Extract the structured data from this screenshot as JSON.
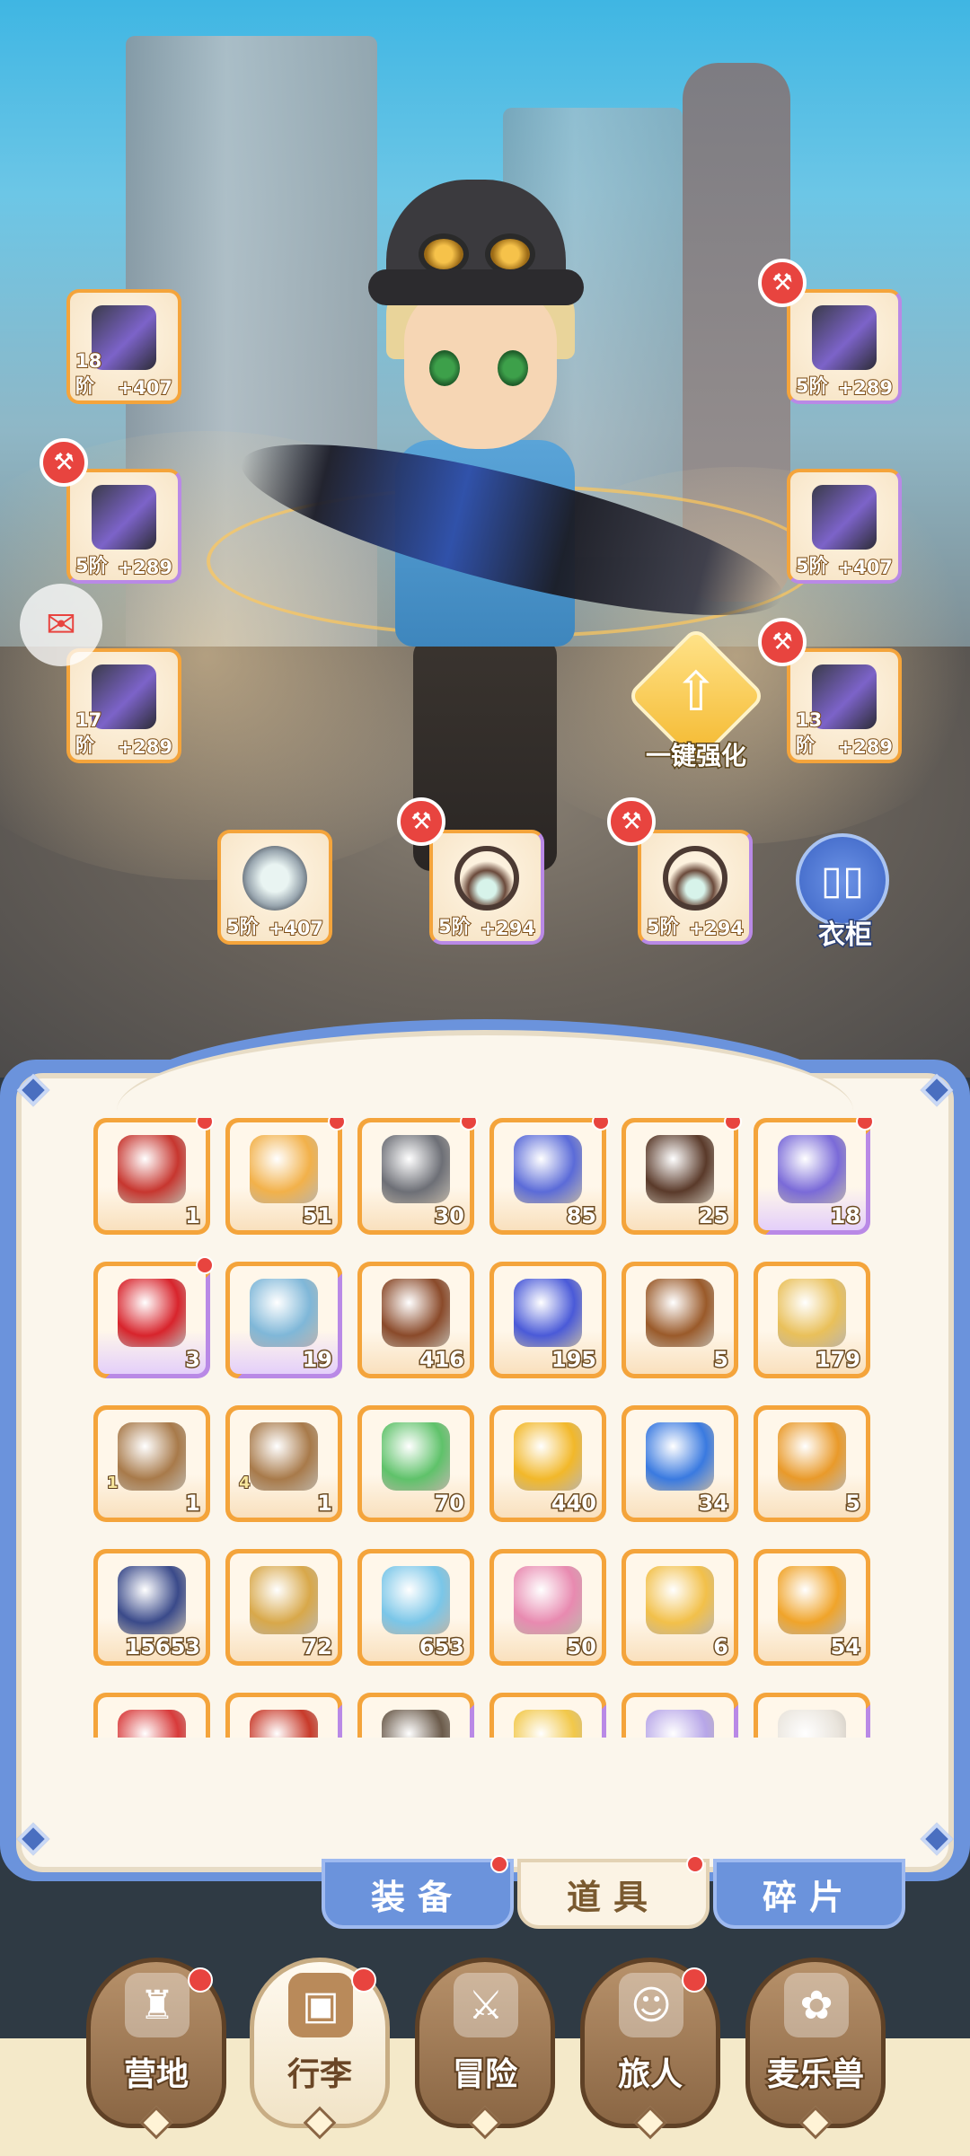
{
  "equipment": {
    "left": [
      {
        "id": "bow",
        "stage": "18阶",
        "bonus": "+407",
        "rarity": "orange",
        "badge": false,
        "art": "bow-art"
      },
      {
        "id": "chest",
        "stage": "5阶",
        "bonus": "+289",
        "rarity": "purple",
        "badge": true,
        "art": ""
      },
      {
        "id": "belt",
        "stage": "17阶",
        "bonus": "+289",
        "rarity": "orange",
        "badge": false,
        "art": ""
      }
    ],
    "right": [
      {
        "id": "helmet",
        "stage": "5阶",
        "bonus": "+289",
        "rarity": "purple",
        "badge": true,
        "art": ""
      },
      {
        "id": "gloves",
        "stage": "5阶",
        "bonus": "+407",
        "rarity": "purple",
        "badge": false,
        "art": ""
      },
      {
        "id": "boots",
        "stage": "13阶",
        "bonus": "+289",
        "rarity": "orange",
        "badge": true,
        "art": ""
      }
    ],
    "bottom": [
      {
        "id": "ring",
        "stage": "5阶",
        "bonus": "+407",
        "rarity": "orange",
        "badge": false,
        "art": "ring-art"
      },
      {
        "id": "necklace-1",
        "stage": "5阶",
        "bonus": "+294",
        "rarity": "purple",
        "badge": true,
        "art": "neck-art"
      },
      {
        "id": "necklace-2",
        "stage": "5阶",
        "bonus": "+294",
        "rarity": "purple",
        "badge": true,
        "art": "neck-art"
      }
    ]
  },
  "actions": {
    "auto_enhance_label": "一键强化",
    "wardrobe_label": "衣柜"
  },
  "inventory": {
    "items": [
      {
        "count": "1",
        "rarity": "orange",
        "dot": true,
        "icon": "treasure-chest-icon",
        "color": "#c7362f"
      },
      {
        "count": "51",
        "rarity": "orange",
        "dot": true,
        "icon": "scroll-fragment-icon",
        "color": "#f2b14a"
      },
      {
        "count": "30",
        "rarity": "orange",
        "dot": true,
        "icon": "ore-fragment-icon",
        "color": "#6d6f76"
      },
      {
        "count": "85",
        "rarity": "orange",
        "dot": true,
        "icon": "blue-fragment-icon",
        "color": "#5b6bd8"
      },
      {
        "count": "25",
        "rarity": "orange",
        "dot": true,
        "icon": "bell-hat-icon",
        "color": "#5a3a2a"
      },
      {
        "count": "18",
        "rarity": "purple",
        "dot": true,
        "icon": "purple-fragment-icon",
        "color": "#7a6ad8"
      },
      {
        "count": "3",
        "rarity": "purple",
        "dot": true,
        "icon": "apple-icon",
        "color": "#d8242c"
      },
      {
        "count": "19",
        "rarity": "purple",
        "dot": false,
        "icon": "silver-chest-icon",
        "color": "#7fb7d8"
      },
      {
        "count": "416",
        "rarity": "orange",
        "dot": false,
        "icon": "brown-ticket-icon",
        "color": "#8a4a2a"
      },
      {
        "count": "195",
        "rarity": "orange",
        "dot": false,
        "icon": "blue-ticket-icon",
        "color": "#4a5ad8"
      },
      {
        "count": "5",
        "rarity": "orange",
        "dot": false,
        "icon": "wood-log-icon",
        "color": "#9a5a2a"
      },
      {
        "count": "179",
        "rarity": "orange",
        "dot": false,
        "icon": "key-spoon-icon",
        "color": "#e9c05a"
      },
      {
        "count": "1",
        "level": "1",
        "rarity": "orange",
        "dot": false,
        "icon": "building-upgrade-icon",
        "color": "#a87a4a"
      },
      {
        "count": "1",
        "level": "4",
        "rarity": "orange",
        "dot": false,
        "icon": "building-upgrade-icon",
        "color": "#a87a4a"
      },
      {
        "count": "70",
        "rarity": "orange",
        "dot": false,
        "icon": "paper-plane-icon",
        "color": "#5fc26a"
      },
      {
        "count": "440",
        "rarity": "orange",
        "dot": false,
        "icon": "gold-star-icon",
        "color": "#f2b82a"
      },
      {
        "count": "34",
        "rarity": "orange",
        "dot": false,
        "icon": "potion-icon",
        "color": "#3a7ae0"
      },
      {
        "count": "5",
        "rarity": "orange",
        "dot": false,
        "icon": "cat-bell-icon",
        "color": "#e99a2a"
      },
      {
        "count": "15653",
        "rarity": "orange",
        "dot": false,
        "icon": "crystal-orb-icon",
        "color": "#3a4a8a"
      },
      {
        "count": "72",
        "rarity": "orange",
        "dot": false,
        "icon": "lyre-icon",
        "color": "#d8a84a"
      },
      {
        "count": "653",
        "rarity": "orange",
        "dot": false,
        "icon": "blue-crystal-icon",
        "color": "#7ac6e8"
      },
      {
        "count": "50",
        "rarity": "orange",
        "dot": false,
        "icon": "rainbow-paint-icon",
        "color": "#e88ab0"
      },
      {
        "count": "6",
        "rarity": "orange",
        "dot": false,
        "icon": "paint-bucket-icon",
        "color": "#f2c04a"
      },
      {
        "count": "54",
        "rarity": "orange",
        "dot": false,
        "icon": "outfit-card-icon",
        "color": "#f0a42a"
      },
      {
        "count": "",
        "rarity": "orange",
        "dot": false,
        "icon": "red-bow-icon",
        "color": "#d83a3a"
      },
      {
        "count": "",
        "rarity": "purple",
        "dot": false,
        "icon": "red-tool-icon",
        "color": "#c83a2a"
      },
      {
        "count": "",
        "rarity": "purple",
        "dot": false,
        "icon": "stick-icon",
        "color": "#6a5a4a"
      },
      {
        "count": "",
        "rarity": "purple",
        "dot": false,
        "icon": "yellow-item-icon",
        "color": "#f2c84a"
      },
      {
        "count": "",
        "rarity": "purple",
        "dot": false,
        "icon": "cat-figure-icon",
        "color": "#b7a6e8"
      },
      {
        "count": "",
        "rarity": "purple",
        "dot": false,
        "icon": "white-item-icon",
        "color": "#e9e4dc"
      }
    ]
  },
  "tabs": [
    {
      "label": "装备",
      "active": false,
      "dot": true
    },
    {
      "label": "道具",
      "active": true,
      "dot": true
    },
    {
      "label": "碎片",
      "active": false,
      "dot": false
    }
  ],
  "nav": [
    {
      "label": "营地",
      "icon": "castle-icon",
      "active": false,
      "dot": true
    },
    {
      "label": "行李",
      "icon": "chest-icon",
      "active": true,
      "dot": true
    },
    {
      "label": "冒险",
      "icon": "crossed-swords-icon",
      "active": false,
      "dot": false
    },
    {
      "label": "旅人",
      "icon": "traveler-icon",
      "active": false,
      "dot": true
    },
    {
      "label": "麦乐兽",
      "icon": "pet-icon",
      "active": false,
      "dot": false
    }
  ]
}
